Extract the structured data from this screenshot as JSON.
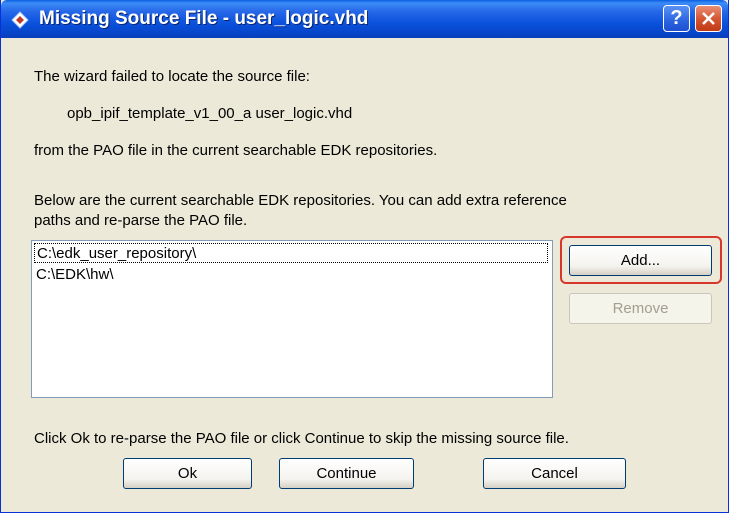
{
  "window": {
    "title": "Missing Source File - user_logic.vhd"
  },
  "message": {
    "line1": "The wizard failed to locate the source file:",
    "file_path": "opb_ipif_template_v1_00_a  user_logic.vhd",
    "line3": "from the PAO file in the current searchable EDK repositories.",
    "repos_intro_1": "Below are the current searchable EDK repositories. You can add extra reference",
    "repos_intro_2": "paths and re-parse the PAO file.",
    "footer": "Click Ok to re-parse the PAO file or click Continue to skip the missing source file."
  },
  "repositories": {
    "items": [
      {
        "path": "C:\\edk_user_repository\\"
      },
      {
        "path": "C:\\EDK\\hw\\"
      }
    ]
  },
  "buttons": {
    "add": "Add...",
    "remove": "Remove",
    "ok": "Ok",
    "continue": "Continue",
    "cancel": "Cancel"
  },
  "titlebar_buttons": {
    "help": "?"
  },
  "colors": {
    "titlebar": "#0a52dd",
    "dialog_bg": "#ece9d8",
    "highlight": "#d8382c"
  }
}
